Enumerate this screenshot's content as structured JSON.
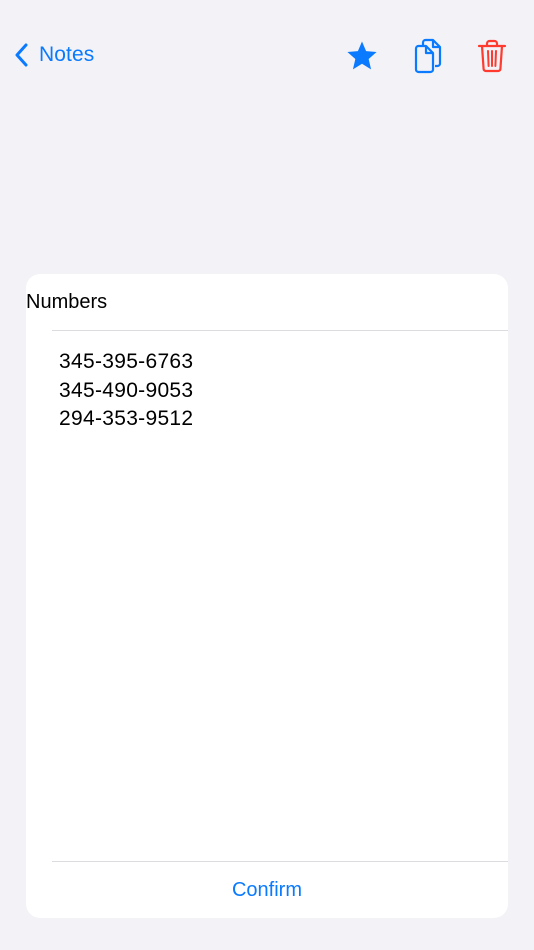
{
  "nav": {
    "back_label": "Notes",
    "back_icon": "chevron-left-icon",
    "actions": [
      {
        "name": "favorite",
        "icon": "star-filled-icon"
      },
      {
        "name": "copy",
        "icon": "copy-documents-icon"
      },
      {
        "name": "delete",
        "icon": "trash-icon"
      }
    ]
  },
  "note": {
    "title": "Numbers",
    "lines": [
      "345-395-6763",
      "345-490-9053",
      "294-353-9512"
    ],
    "confirm_label": "Confirm"
  },
  "colors": {
    "accent": "#0a7aff",
    "destructive": "#ff3b30",
    "background": "#f2f2f7",
    "card": "#ffffff"
  }
}
